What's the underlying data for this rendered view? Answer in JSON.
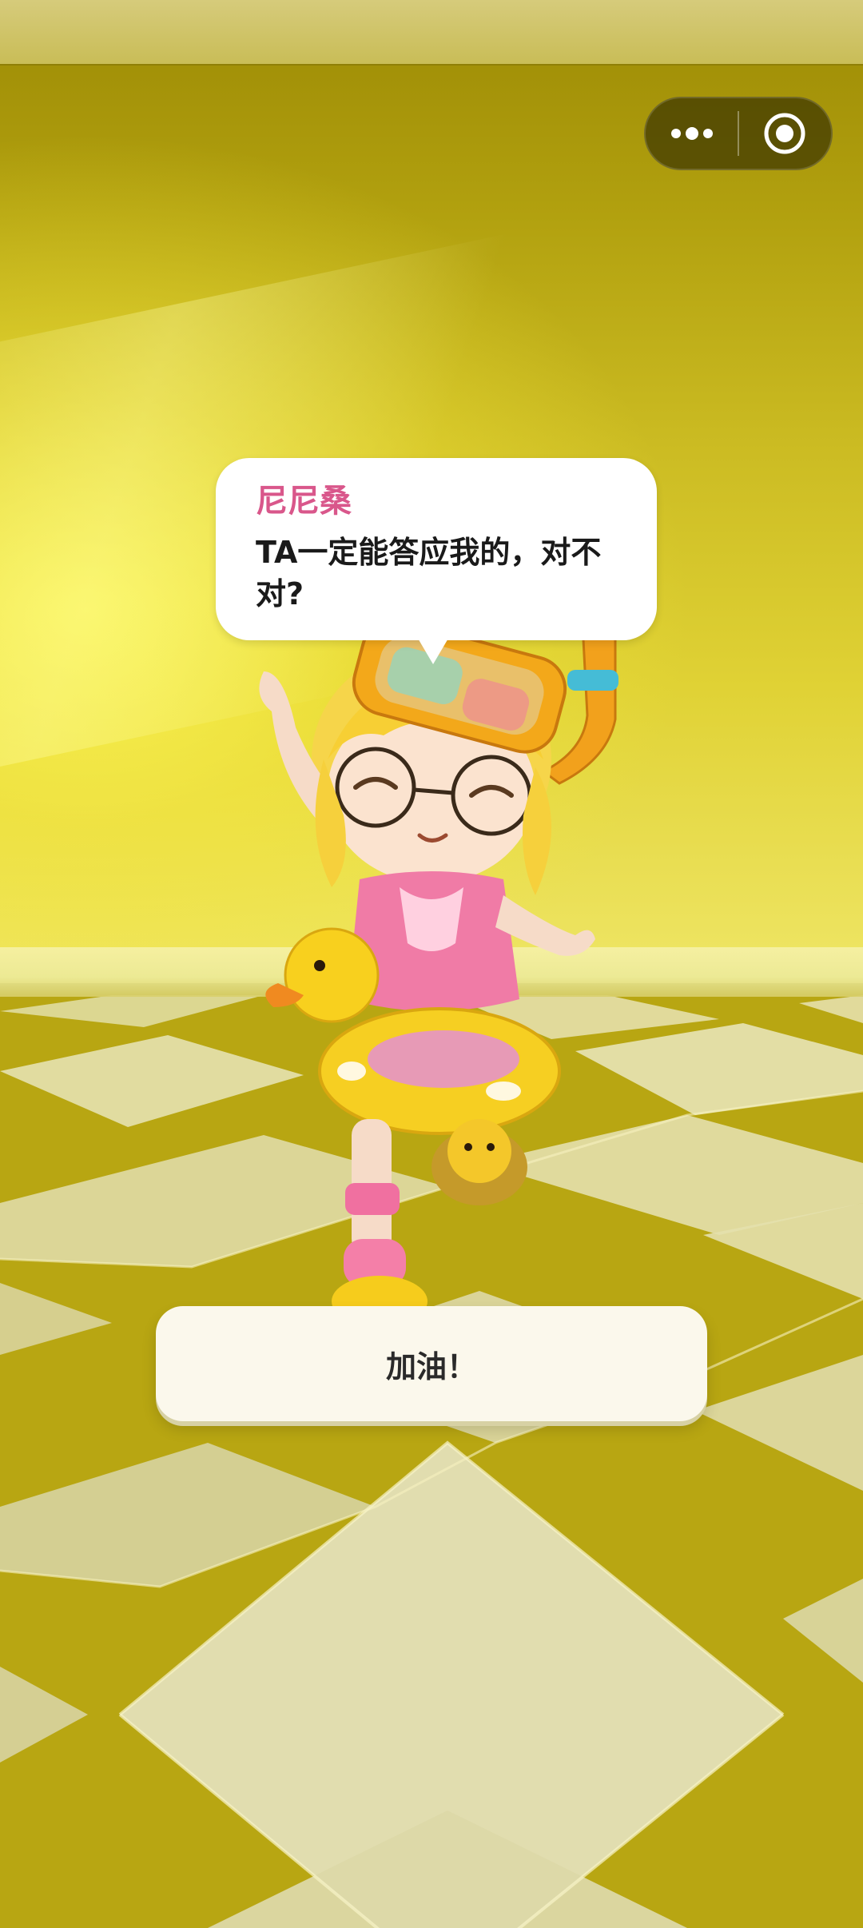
{
  "header": {
    "capsule": {
      "more_icon": "more-dots-icon",
      "close_icon": "target-circle-icon"
    }
  },
  "dialog": {
    "speaker": "尼尼桑",
    "line": "TA一定能答应我的，对不对?"
  },
  "choices": [
    {
      "label": "加油！"
    }
  ],
  "colors": {
    "wall": "#cbbb22",
    "floor_dark": "#b9a712",
    "floor_light": "#dedbb2",
    "speaker_name": "#d9578b",
    "button_bg": "#fbf8ec"
  }
}
